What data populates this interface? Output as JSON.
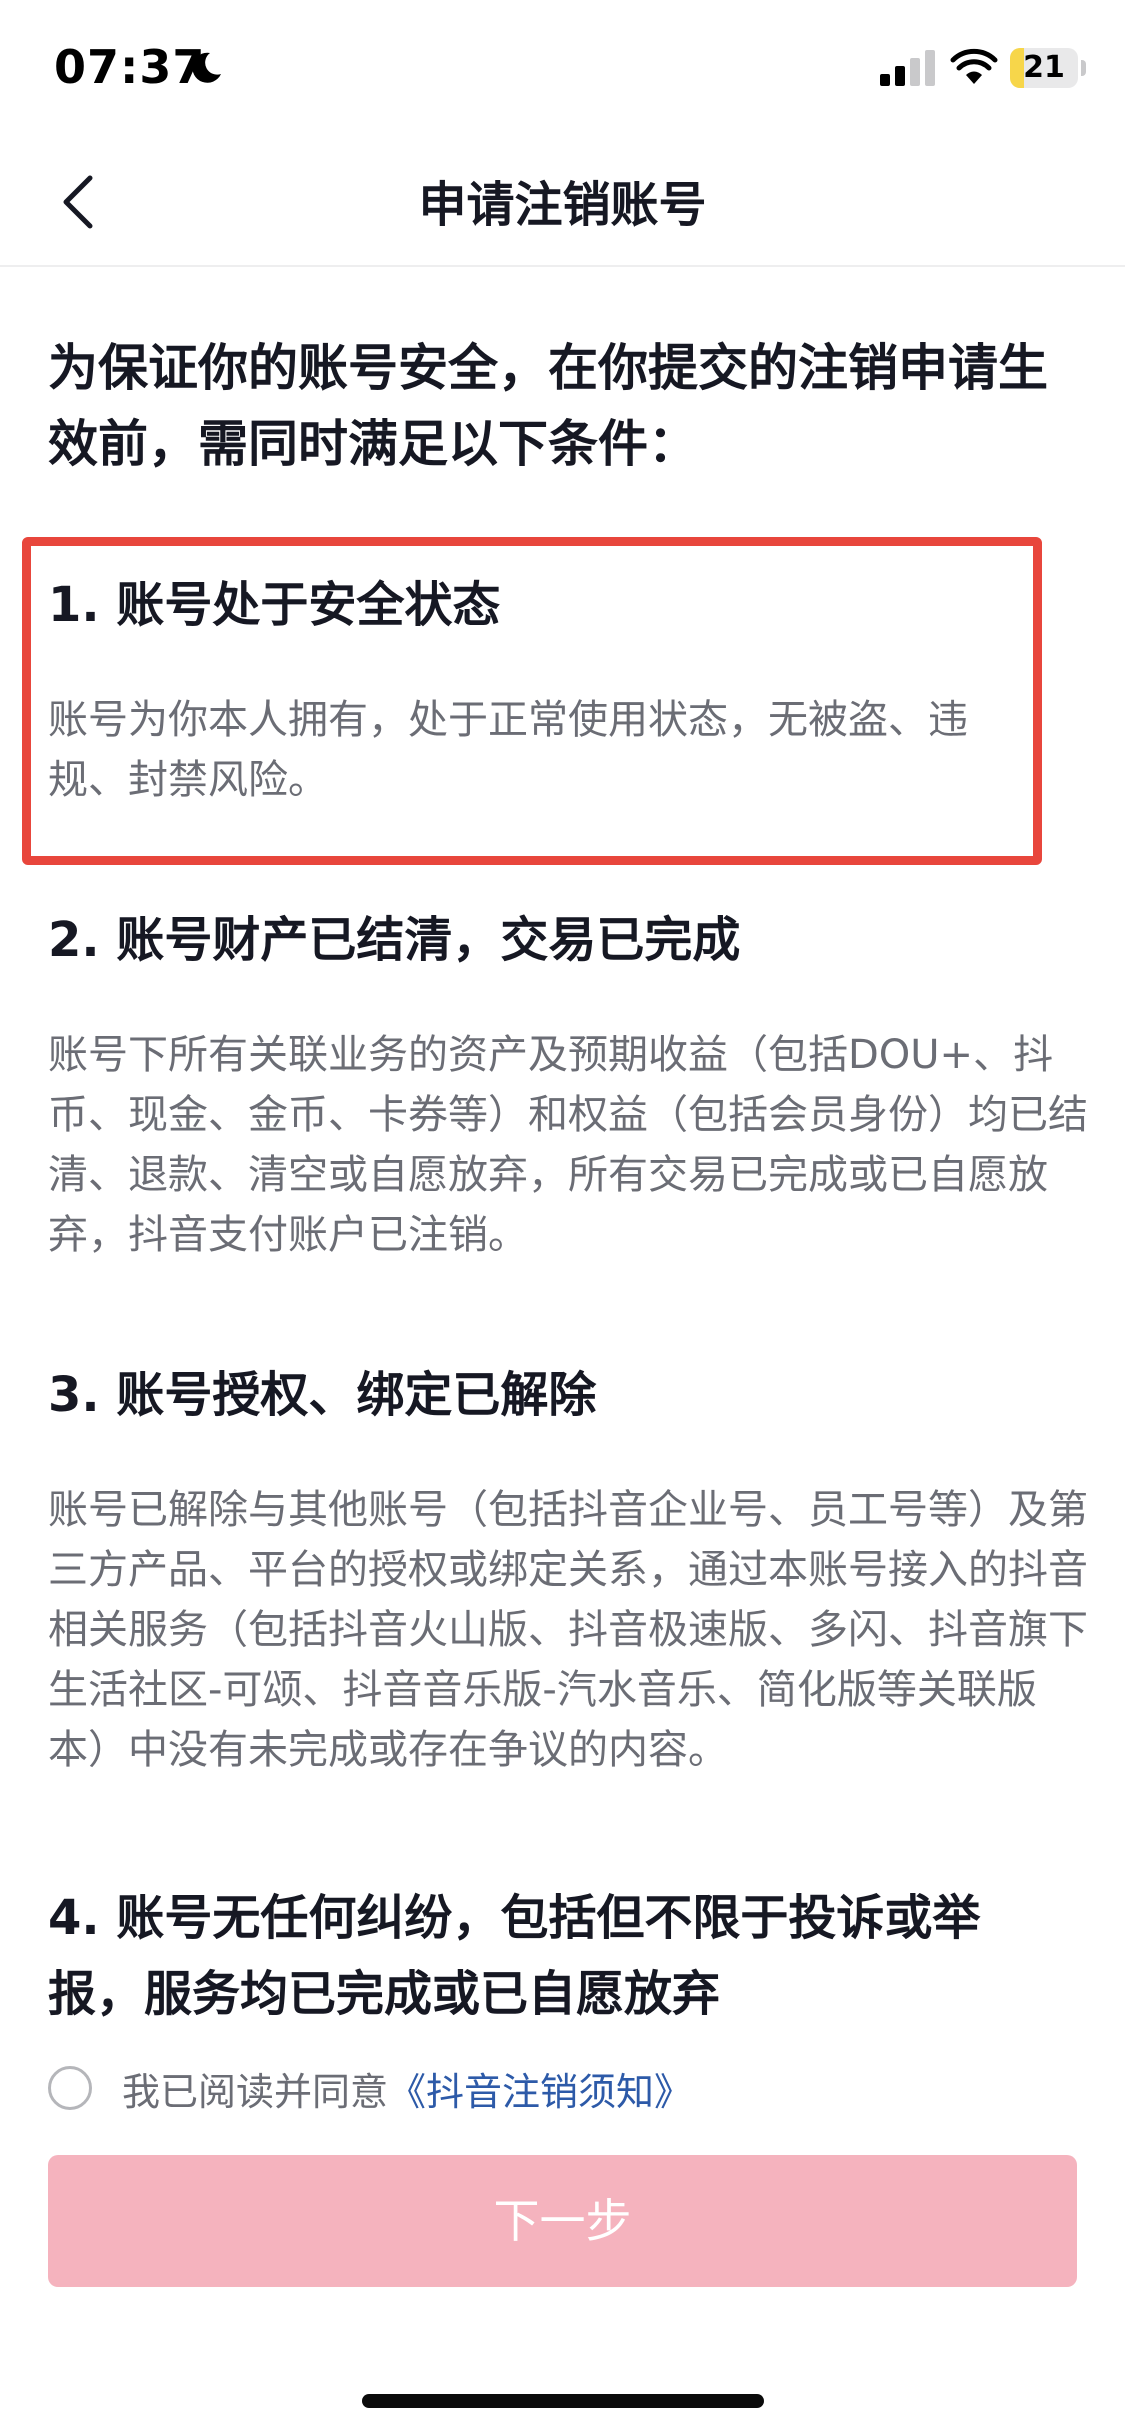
{
  "status_bar": {
    "time": "07:37",
    "battery_level": "21",
    "battery_fraction": 0.21
  },
  "nav": {
    "title": "申请注销账号",
    "back_icon": "chevron-left-icon"
  },
  "intro": "为保证你的账号安全，在你提交的注销申请生效前，需同时满足以下条件：",
  "conditions": [
    {
      "title": "1. 账号处于安全状态",
      "desc": "账号为你本人拥有，处于正常使用状态，无被盗、违规、封禁风险。"
    },
    {
      "title": "2. 账号财产已结清，交易已完成",
      "desc": "账号下所有关联业务的资产及预期收益（包括DOU+、抖币、现金、金币、卡券等）和权益（包括会员身份）均已结清、退款、清空或自愿放弃，所有交易已完成或已自愿放弃，抖音支付账户已注销。"
    },
    {
      "title": "3. 账号授权、绑定已解除",
      "desc": "账号已解除与其他账号（包括抖音企业号、员工号等）及第三方产品、平台的授权或绑定关系，通过本账号接入的抖音相关服务（包括抖音火山版、抖音极速版、多闪、抖音旗下生活社区-可颂、抖音音乐版-汽水音乐、简化版等关联版本）中没有未完成或存在争议的内容。"
    },
    {
      "title": "4. 账号无任何纠纷，包括但不限于投诉或举报，服务均已完成或已自愿放弃"
    }
  ],
  "agreement": {
    "prefix": "我已阅读并同意",
    "link": "《抖音注销须知》",
    "checked": false
  },
  "next_button": "下一步",
  "colors": {
    "highlight_border": "#e8463c",
    "button_disabled": "#f5b3be",
    "link": "#2d5aa8",
    "body_text": "#161823",
    "secondary_text": "#6b6d75"
  }
}
